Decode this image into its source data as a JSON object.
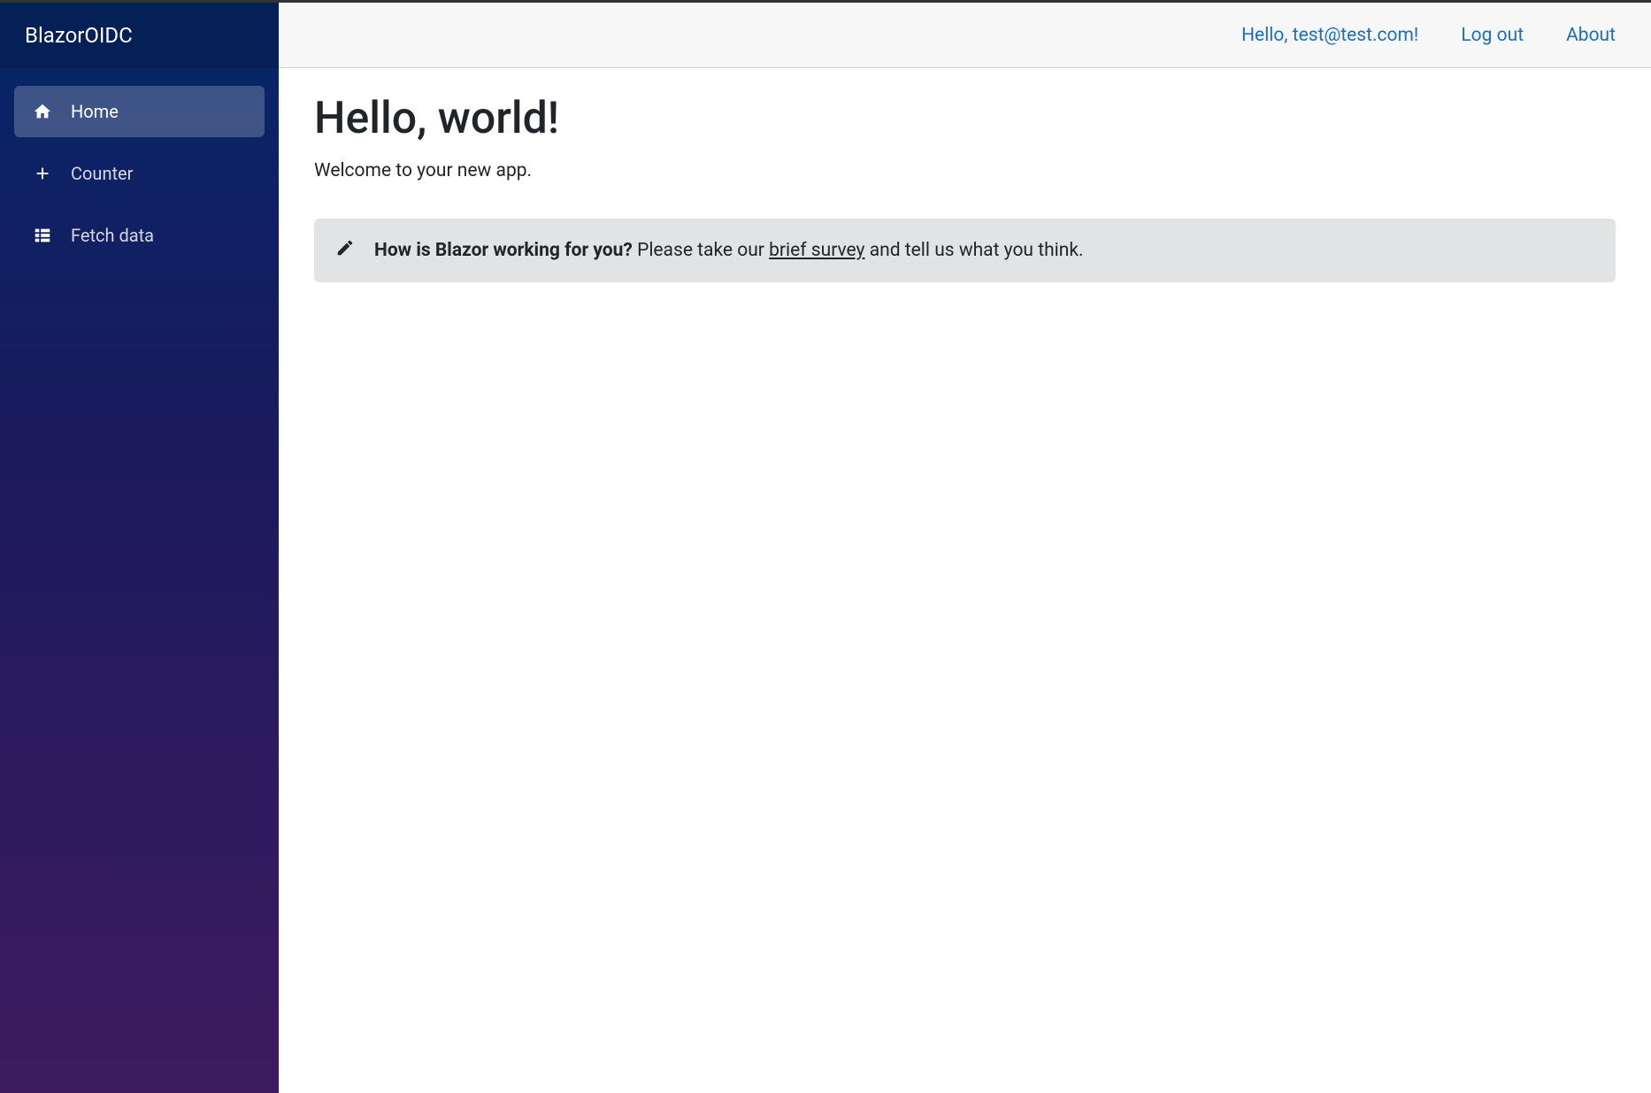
{
  "sidebar": {
    "brand": "BlazorOIDC",
    "items": [
      {
        "label": "Home"
      },
      {
        "label": "Counter"
      },
      {
        "label": "Fetch data"
      }
    ]
  },
  "header": {
    "greeting": "Hello, test@test.com!",
    "logout": "Log out",
    "about": "About"
  },
  "main": {
    "title": "Hello, world!",
    "welcome": "Welcome to your new app.",
    "survey": {
      "bold": "How is Blazor working for you?",
      "lead": " Please take our ",
      "link": "brief survey",
      "tail": " and tell us what you think."
    }
  }
}
